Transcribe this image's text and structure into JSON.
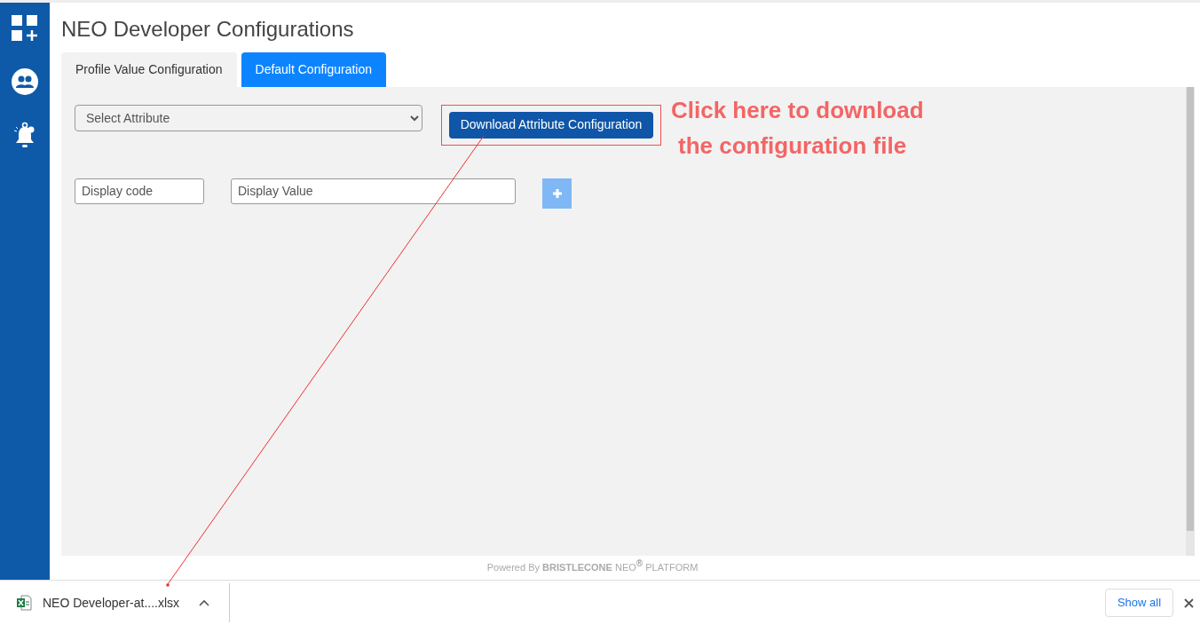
{
  "page": {
    "title": "NEO Developer Configurations"
  },
  "tabs": [
    {
      "label": "Profile Value Configuration",
      "selected": false
    },
    {
      "label": "Default Configuration",
      "selected": true
    }
  ],
  "form": {
    "attribute_select": {
      "placeholder": "Select Attribute"
    },
    "download_button": "Download Attribute Configuration",
    "display_code": {
      "placeholder": "Display code"
    },
    "display_value": {
      "placeholder": "Display Value"
    }
  },
  "annotation": {
    "lines": [
      "Click here to download",
      "the configuration file"
    ]
  },
  "footer": "Powered By **BRISTLECONE** NEO$^{®}$ PLATFORM",
  "download_bar": {
    "file_name": "NEO Developer-at....xlsx",
    "show_all": "Show all"
  }
}
